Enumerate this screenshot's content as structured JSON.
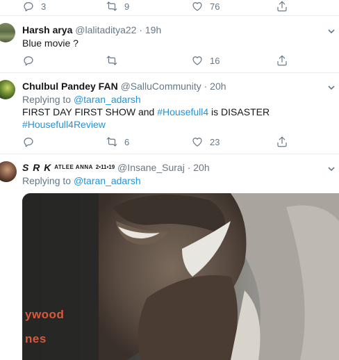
{
  "top_actions": {
    "reply_count": "3",
    "retweet_count": "9",
    "like_count": "76"
  },
  "tweets": [
    {
      "name": "Harsh arya",
      "handle": "@lalitaditya22",
      "time": "19h",
      "text": "Blue movie ?",
      "reply_count": "",
      "retweet_count": "",
      "like_count": "16"
    },
    {
      "name": "Chulbul Pandey FAN",
      "handle": "@SalluCommunity",
      "time": "20h",
      "replying_prefix": "Replying to",
      "replying_to": "@taran_adarsh",
      "text_before": "FIRST DAY FIRST SHOW and ",
      "hashtag1": "#Housefull4",
      "text_after": " is DISASTER",
      "hashtag2": "#Housefull4Review",
      "reply_count": "",
      "retweet_count": "6",
      "like_count": "23"
    },
    {
      "name_main": "S R K",
      "name_suffix": "ATLEE ANNA",
      "name_date": "2•11•19",
      "handle": "@Insane_Suraj",
      "time": "20h",
      "replying_prefix": "Replying to",
      "replying_to": "@taran_adarsh",
      "media_watermark_line1": "ywood",
      "media_watermark_line2": "nes"
    }
  ],
  "separator": "·",
  "colors": {
    "link": "#1b95e0",
    "muted": "#657786",
    "divider": "#e6ecf0"
  },
  "icons": [
    "reply-icon",
    "retweet-icon",
    "like-icon",
    "share-icon",
    "chevron-down-icon"
  ]
}
